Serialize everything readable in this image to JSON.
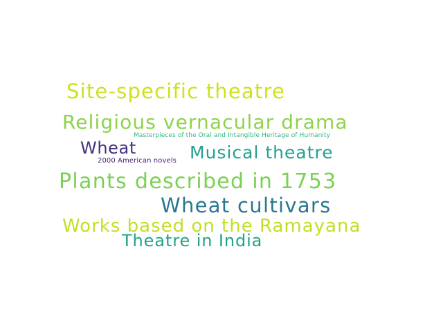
{
  "wordcloud": {
    "words": [
      {
        "text": "Site-specific theatre",
        "color": "#d0e11c"
      },
      {
        "text": "Religious vernacular drama",
        "color": "#8ed34a"
      },
      {
        "text": "Masterpieces of the Oral and Intangible Heritage of Humanity",
        "color": "#2fb47c"
      },
      {
        "text": "Wheat",
        "color": "#46327e"
      },
      {
        "text": "Musical theatre",
        "color": "#25a18e"
      },
      {
        "text": "2000 American novels",
        "color": "#482173"
      },
      {
        "text": "Plants described in 1753",
        "color": "#7ad151"
      },
      {
        "text": "Wheat cultivars",
        "color": "#2a788e"
      },
      {
        "text": "Works based on the Ramayana",
        "color": "#c2df23"
      },
      {
        "text": "Theatre in India",
        "color": "#20a386"
      }
    ]
  }
}
